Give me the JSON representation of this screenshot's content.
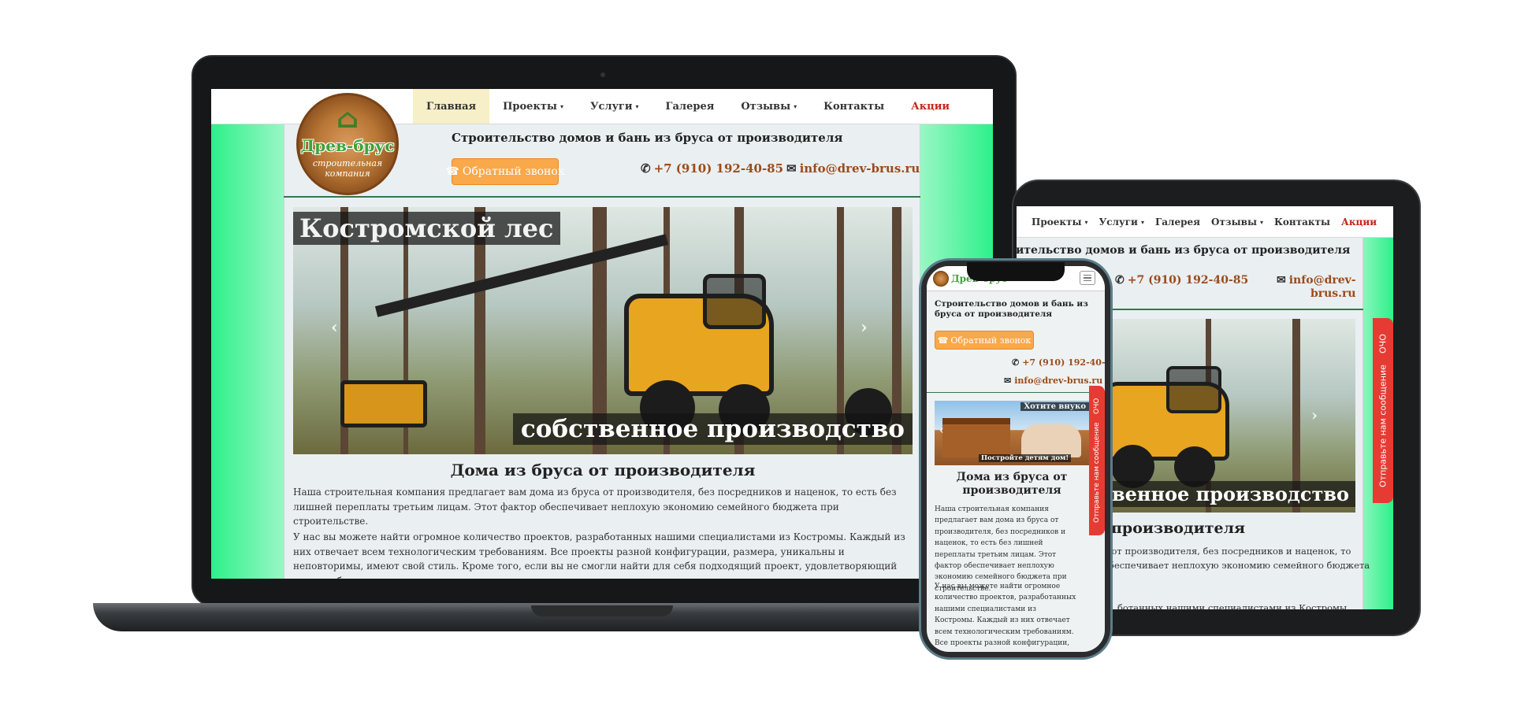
{
  "site": {
    "logo": {
      "name": "Древ-брус",
      "sub": "строительная компания"
    },
    "nav": [
      "Главная",
      "Проекты",
      "Услуги",
      "Галерея",
      "Отзывы",
      "Контакты",
      "Акции"
    ],
    "tagline": "Строительство домов и бань из бруса от производителя",
    "callback_button": "Обратный звонок",
    "phone": "+7 (910) 192-40-85",
    "email": "info@drev-brus.ru",
    "email_wrapped_line1": "info@drev-",
    "email_wrapped_line2": "brus.ru",
    "slider": {
      "caption_top": "Костромской лес",
      "caption_bottom": "собственное производство",
      "caption_bottom_partial": "твенное производство",
      "phone_slide_top": "Хотите внуко",
      "phone_slide_bottom": "Постройте детям дом!"
    },
    "heading": "Дома из бруса от производителя",
    "heading_partial": "производителя",
    "para1": "Наша строительная компания предлагает вам дома из бруса от производителя, без посредников и наценок, то есть без лишней переплаты третьим лицам. Этот фактор обеспечивает неплохую экономию семейного бюджета при строительстве.",
    "para2": "У нас вы можете найти огромное количество проектов, разработанных нашими специалистами из Костромы. Каждый из них отвечает всем технологическим требованиям. Все проекты разной конфигурации, размера, уникальны и неповторимы, имеют свой стиль. Кроме того, если вы не смогли найти для себя подходящий проект, удовлетворяющий всем требованиям, то мы с удовольствием спроектируем",
    "tablet_para1_l1": "а от производителя, без посредников и наценок, то",
    "tablet_para1_l2": "обеспечивает неплохую экономию семейного бюджета",
    "tablet_para2_l1": "ботанных нашими специалистами из Костромы.",
    "phone_para1": "Наша строительная компания предлагает вам дома из бруса от производителя, без посредников и наценок, то есть без лишней переплаты третьим лицам. Этот фактор обеспечивает неплохую экономию семейного бюджета при строительстве.",
    "phone_para2": "У нас вы можете найти огромное количество проектов, разработанных нашими специалистами из Костромы. Каждый из них отвечает всем технологическим требованиям. Все проекты разной конфигурации, размера, уникальны и неповторимы, имеют свой стиль.",
    "side_tab": "Отправьте нам сообщение",
    "side_tab_badge": "ОЧО"
  },
  "icons": {
    "phone": "phone-icon",
    "mail": "envelope-icon",
    "callback": "handset-icon",
    "prev": "chevron-left-icon",
    "next": "chevron-right-icon",
    "menu": "hamburger-icon"
  },
  "colors": {
    "accent_green": "#2df08a",
    "promo_red": "#c3261c",
    "button_orange": "#f9a84a",
    "link_brown": "#9b4b1a"
  }
}
